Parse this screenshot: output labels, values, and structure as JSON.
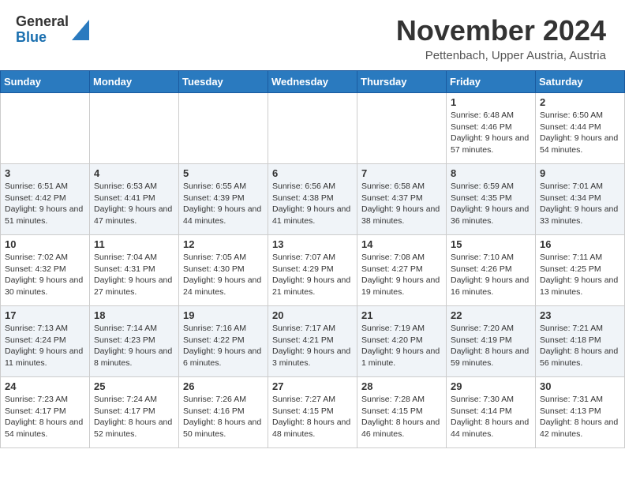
{
  "header": {
    "logo_general": "General",
    "logo_blue": "Blue",
    "month_title": "November 2024",
    "location": "Pettenbach, Upper Austria, Austria"
  },
  "days_of_week": [
    "Sunday",
    "Monday",
    "Tuesday",
    "Wednesday",
    "Thursday",
    "Friday",
    "Saturday"
  ],
  "weeks": [
    [
      {
        "day": "",
        "info": ""
      },
      {
        "day": "",
        "info": ""
      },
      {
        "day": "",
        "info": ""
      },
      {
        "day": "",
        "info": ""
      },
      {
        "day": "",
        "info": ""
      },
      {
        "day": "1",
        "info": "Sunrise: 6:48 AM\nSunset: 4:46 PM\nDaylight: 9 hours\nand 57 minutes."
      },
      {
        "day": "2",
        "info": "Sunrise: 6:50 AM\nSunset: 4:44 PM\nDaylight: 9 hours\nand 54 minutes."
      }
    ],
    [
      {
        "day": "3",
        "info": "Sunrise: 6:51 AM\nSunset: 4:42 PM\nDaylight: 9 hours\nand 51 minutes."
      },
      {
        "day": "4",
        "info": "Sunrise: 6:53 AM\nSunset: 4:41 PM\nDaylight: 9 hours\nand 47 minutes."
      },
      {
        "day": "5",
        "info": "Sunrise: 6:55 AM\nSunset: 4:39 PM\nDaylight: 9 hours\nand 44 minutes."
      },
      {
        "day": "6",
        "info": "Sunrise: 6:56 AM\nSunset: 4:38 PM\nDaylight: 9 hours\nand 41 minutes."
      },
      {
        "day": "7",
        "info": "Sunrise: 6:58 AM\nSunset: 4:37 PM\nDaylight: 9 hours\nand 38 minutes."
      },
      {
        "day": "8",
        "info": "Sunrise: 6:59 AM\nSunset: 4:35 PM\nDaylight: 9 hours\nand 36 minutes."
      },
      {
        "day": "9",
        "info": "Sunrise: 7:01 AM\nSunset: 4:34 PM\nDaylight: 9 hours\nand 33 minutes."
      }
    ],
    [
      {
        "day": "10",
        "info": "Sunrise: 7:02 AM\nSunset: 4:32 PM\nDaylight: 9 hours\nand 30 minutes."
      },
      {
        "day": "11",
        "info": "Sunrise: 7:04 AM\nSunset: 4:31 PM\nDaylight: 9 hours\nand 27 minutes."
      },
      {
        "day": "12",
        "info": "Sunrise: 7:05 AM\nSunset: 4:30 PM\nDaylight: 9 hours\nand 24 minutes."
      },
      {
        "day": "13",
        "info": "Sunrise: 7:07 AM\nSunset: 4:29 PM\nDaylight: 9 hours\nand 21 minutes."
      },
      {
        "day": "14",
        "info": "Sunrise: 7:08 AM\nSunset: 4:27 PM\nDaylight: 9 hours\nand 19 minutes."
      },
      {
        "day": "15",
        "info": "Sunrise: 7:10 AM\nSunset: 4:26 PM\nDaylight: 9 hours\nand 16 minutes."
      },
      {
        "day": "16",
        "info": "Sunrise: 7:11 AM\nSunset: 4:25 PM\nDaylight: 9 hours\nand 13 minutes."
      }
    ],
    [
      {
        "day": "17",
        "info": "Sunrise: 7:13 AM\nSunset: 4:24 PM\nDaylight: 9 hours\nand 11 minutes."
      },
      {
        "day": "18",
        "info": "Sunrise: 7:14 AM\nSunset: 4:23 PM\nDaylight: 9 hours\nand 8 minutes."
      },
      {
        "day": "19",
        "info": "Sunrise: 7:16 AM\nSunset: 4:22 PM\nDaylight: 9 hours\nand 6 minutes."
      },
      {
        "day": "20",
        "info": "Sunrise: 7:17 AM\nSunset: 4:21 PM\nDaylight: 9 hours\nand 3 minutes."
      },
      {
        "day": "21",
        "info": "Sunrise: 7:19 AM\nSunset: 4:20 PM\nDaylight: 9 hours\nand 1 minute."
      },
      {
        "day": "22",
        "info": "Sunrise: 7:20 AM\nSunset: 4:19 PM\nDaylight: 8 hours\nand 59 minutes."
      },
      {
        "day": "23",
        "info": "Sunrise: 7:21 AM\nSunset: 4:18 PM\nDaylight: 8 hours\nand 56 minutes."
      }
    ],
    [
      {
        "day": "24",
        "info": "Sunrise: 7:23 AM\nSunset: 4:17 PM\nDaylight: 8 hours\nand 54 minutes."
      },
      {
        "day": "25",
        "info": "Sunrise: 7:24 AM\nSunset: 4:17 PM\nDaylight: 8 hours\nand 52 minutes."
      },
      {
        "day": "26",
        "info": "Sunrise: 7:26 AM\nSunset: 4:16 PM\nDaylight: 8 hours\nand 50 minutes."
      },
      {
        "day": "27",
        "info": "Sunrise: 7:27 AM\nSunset: 4:15 PM\nDaylight: 8 hours\nand 48 minutes."
      },
      {
        "day": "28",
        "info": "Sunrise: 7:28 AM\nSunset: 4:15 PM\nDaylight: 8 hours\nand 46 minutes."
      },
      {
        "day": "29",
        "info": "Sunrise: 7:30 AM\nSunset: 4:14 PM\nDaylight: 8 hours\nand 44 minutes."
      },
      {
        "day": "30",
        "info": "Sunrise: 7:31 AM\nSunset: 4:13 PM\nDaylight: 8 hours\nand 42 minutes."
      }
    ]
  ]
}
